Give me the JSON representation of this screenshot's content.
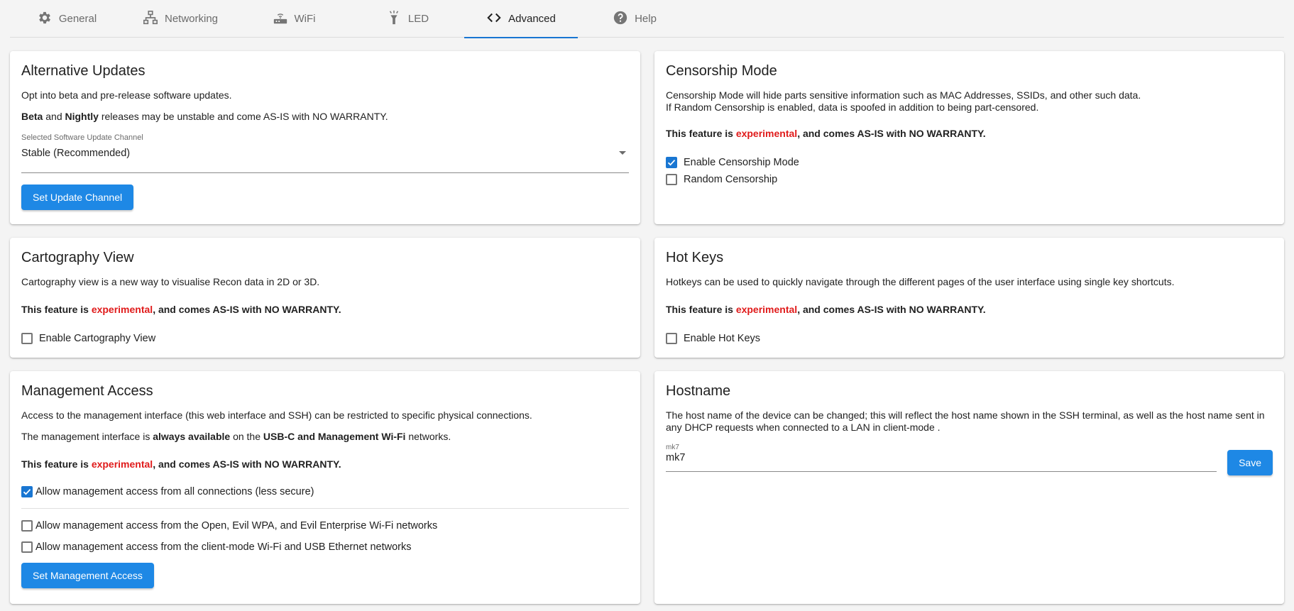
{
  "tabs": [
    {
      "label": "General",
      "icon": "gear-icon"
    },
    {
      "label": "Networking",
      "icon": "network-icon"
    },
    {
      "label": "WiFi",
      "icon": "router-icon"
    },
    {
      "label": "LED",
      "icon": "flashlight-icon"
    },
    {
      "label": "Advanced",
      "icon": "code-icon",
      "active": true
    },
    {
      "label": "Help",
      "icon": "help-icon"
    }
  ],
  "colors": {
    "accent": "#1976d2",
    "button": "#1e88e5",
    "experimental": "#e01b1b"
  },
  "warning": {
    "prefix": "This feature is ",
    "experimental": "experimental",
    "suffix": ", and comes AS-IS with NO WARRANTY."
  },
  "alt_updates": {
    "title": "Alternative Updates",
    "desc": "Opt into beta and pre-release software updates.",
    "beta": "Beta",
    "and": " and ",
    "nightly": "Nightly",
    "rest": " releases may be unstable and come AS-IS with NO WARRANTY.",
    "select_label": "Selected Software Update Channel",
    "select_value": "Stable (Recommended)",
    "button": "Set Update Channel"
  },
  "censorship": {
    "title": "Censorship Mode",
    "desc1": "Censorship Mode will hide parts sensitive information such as MAC Addresses, SSIDs, and other such data.",
    "desc2": "If Random Censorship is enabled, data is spoofed in addition to being part-censored.",
    "enable_label": "Enable Censorship Mode",
    "enable_checked": true,
    "random_label": "Random Censorship",
    "random_checked": false
  },
  "cartography": {
    "title": "Cartography View",
    "desc": "Cartography view is a new way to visualise Recon data in 2D or 3D.",
    "enable_label": "Enable Cartography View",
    "enable_checked": false
  },
  "hotkeys": {
    "title": "Hot Keys",
    "desc": "Hotkeys can be used to quickly navigate through the different pages of the user interface using single key shortcuts.",
    "enable_label": "Enable Hot Keys",
    "enable_checked": false
  },
  "management": {
    "title": "Management Access",
    "desc": "Access to the management interface (this web interface and SSH) can be restricted to specific physical connections.",
    "avail_prefix": "The management interface is ",
    "avail_bold": "always available",
    "avail_mid": " on the ",
    "avail_bold2": "USB-C and Management Wi-Fi",
    "avail_suffix": " networks.",
    "all_label": "Allow management access from all connections (less secure)",
    "all_checked": true,
    "open_label": "Allow management access from the Open, Evil WPA, and Evil Enterprise Wi-Fi networks",
    "open_checked": false,
    "client_label": "Allow management access from the client-mode Wi-Fi and USB Ethernet networks",
    "client_checked": false,
    "button": "Set Management Access"
  },
  "hostname": {
    "title": "Hostname",
    "desc": "The host name of the device can be changed; this will reflect the host name shown in the SSH terminal, as well as the host name sent in any DHCP requests when connected to a LAN in client-mode .",
    "field_label": "mk7",
    "field_value": "mk7",
    "button": "Save"
  }
}
